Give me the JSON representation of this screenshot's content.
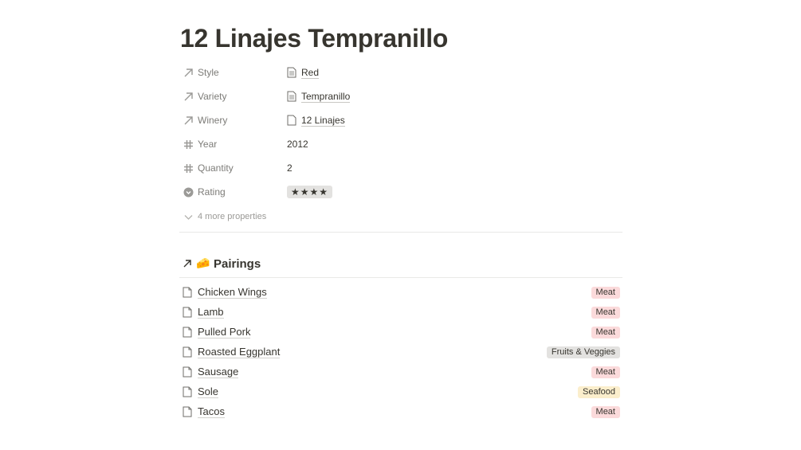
{
  "page": {
    "title": "12 Linajes Tempranillo"
  },
  "properties": [
    {
      "name": "Style",
      "icon": "relation-arrow-icon",
      "value": "Red",
      "value_type": "relation"
    },
    {
      "name": "Variety",
      "icon": "relation-arrow-icon",
      "value": "Tempranillo",
      "value_type": "relation"
    },
    {
      "name": "Winery",
      "icon": "relation-arrow-icon",
      "value": "12 Linajes",
      "value_type": "relation"
    },
    {
      "name": "Year",
      "icon": "number-hash-icon",
      "value": "2012",
      "value_type": "number"
    },
    {
      "name": "Quantity",
      "icon": "number-hash-icon",
      "value": "2",
      "value_type": "number"
    },
    {
      "name": "Rating",
      "icon": "select-icon",
      "value": "★★★★",
      "value_type": "select"
    }
  ],
  "more_properties": {
    "label": "4 more properties"
  },
  "pairings": {
    "emoji": "🧀",
    "title": "Pairings",
    "items": [
      {
        "label": "Chicken Wings",
        "tag": "Meat",
        "tag_color": "#fbdadb"
      },
      {
        "label": "Lamb",
        "tag": "Meat",
        "tag_color": "#fbdadb"
      },
      {
        "label": "Pulled Pork",
        "tag": "Meat",
        "tag_color": "#fbdadb"
      },
      {
        "label": "Roasted Eggplant",
        "tag": "Fruits & Veggies",
        "tag_color": "#e3e2e0"
      },
      {
        "label": "Sausage",
        "tag": "Meat",
        "tag_color": "#fbdadb"
      },
      {
        "label": "Sole",
        "tag": "Seafood",
        "tag_color": "#fbeecc"
      },
      {
        "label": "Tacos",
        "tag": "Meat",
        "tag_color": "#fbdadb"
      }
    ]
  }
}
